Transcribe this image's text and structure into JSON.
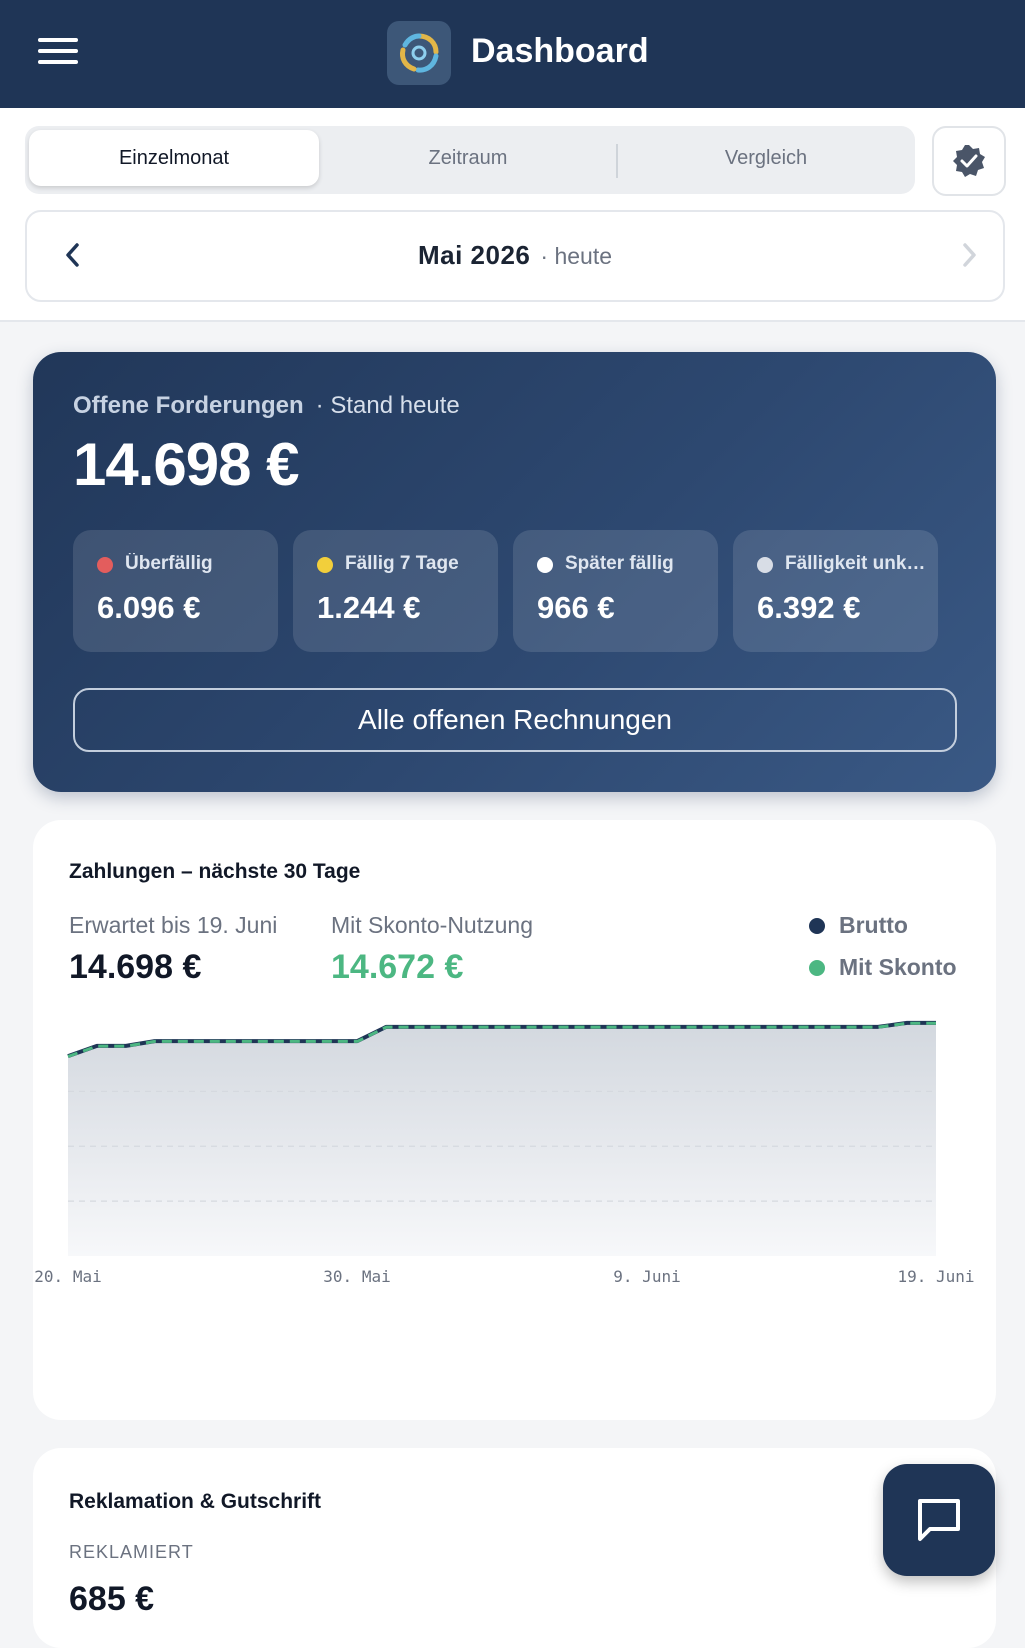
{
  "header": {
    "title": "Dashboard",
    "menu_icon": "hamburger-icon",
    "logo_icon": "spiral-logo-icon"
  },
  "tabs": [
    {
      "label": "Einzelmonat",
      "active": true
    },
    {
      "label": "Zeitraum",
      "active": false
    },
    {
      "label": "Vergleich",
      "active": false
    }
  ],
  "month_nav": {
    "label": "Mai 2026",
    "sub": "· heute"
  },
  "receivables": {
    "title": "Offene Forderungen",
    "sub": "· Stand heute",
    "total": "14.698 €",
    "stats": [
      {
        "label": "Überfällig",
        "value": "6.096 €",
        "color": "#e35d5d"
      },
      {
        "label": "Fällig 7 Tage",
        "value": "1.244 €",
        "color": "#f2cf3b"
      },
      {
        "label": "Später fällig",
        "value": "966 €",
        "color": "#ffffff"
      },
      {
        "label": "Fälligkeit unklar",
        "value": "6.392 €",
        "color": "#d8dde6"
      }
    ],
    "button": "Alle offenen Rechnungen"
  },
  "payments": {
    "title": "Zahlungen – nächste 30 Tage",
    "expected_label": "Erwartet bis 19. Juni",
    "expected_value": "14.698 €",
    "skonto_label": "Mit Skonto-Nutzung",
    "skonto_value": "14.672 €",
    "legend": [
      {
        "name": "Brutto",
        "color": "#1f3556"
      },
      {
        "name": "Mit Skonto",
        "color": "#4cb782"
      }
    ]
  },
  "chart_data": {
    "type": "area",
    "x_tick_labels": [
      "20. Mai",
      "30. Mai",
      "9. Juni",
      "19. Juni"
    ],
    "x": [
      0,
      1,
      2,
      3,
      4,
      5,
      6,
      7,
      8,
      9,
      10,
      11,
      12,
      13,
      14,
      15,
      16,
      17,
      18,
      19,
      20,
      21,
      22,
      23,
      24,
      25,
      26,
      27,
      28,
      29,
      30
    ],
    "series": [
      {
        "name": "Brutto",
        "values": [
          12600,
          13250,
          13250,
          13550,
          13550,
          13550,
          13550,
          13550,
          13550,
          13550,
          13550,
          14450,
          14450,
          14450,
          14450,
          14450,
          14450,
          14450,
          14450,
          14450,
          14450,
          14450,
          14450,
          14450,
          14450,
          14450,
          14450,
          14450,
          14450,
          14698,
          14698
        ]
      },
      {
        "name": "Mit Skonto",
        "values": [
          12580,
          13230,
          13230,
          13530,
          13530,
          13530,
          13530,
          13530,
          13530,
          13530,
          13530,
          14430,
          14430,
          14430,
          14430,
          14430,
          14430,
          14430,
          14430,
          14430,
          14430,
          14430,
          14430,
          14430,
          14430,
          14430,
          14430,
          14430,
          14430,
          14672,
          14672
        ]
      }
    ],
    "ylim": [
      0,
      15000
    ],
    "grid": true
  },
  "complaints": {
    "title": "Reklamation & Gutschrift",
    "label": "REKLAMIERT",
    "value": "685 €"
  },
  "fab": {
    "icon": "chat-icon"
  }
}
